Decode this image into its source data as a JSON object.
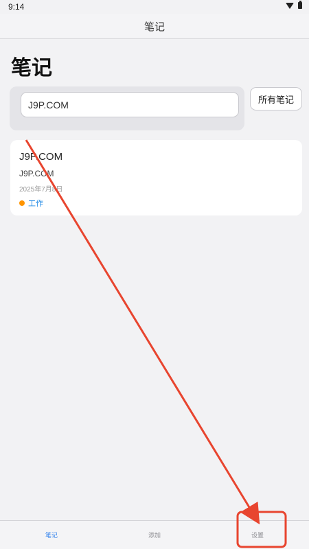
{
  "status_bar": {
    "time": "9:14"
  },
  "nav": {
    "title": "笔记"
  },
  "page": {
    "title": "笔记"
  },
  "search": {
    "value": "J9P.COM"
  },
  "filter": {
    "label": "所有笔记"
  },
  "notes": [
    {
      "title": "J9P.COM",
      "body": "J9P.COM",
      "date": "2025年7月8日",
      "tag": "工作",
      "tag_color": "#ff9500"
    }
  ],
  "tabs": [
    {
      "label": "笔记",
      "active": true
    },
    {
      "label": "添加",
      "active": false
    },
    {
      "label": "设置",
      "active": false
    }
  ],
  "colors": {
    "accent": "#2f80ed",
    "annotation": "#e8452f",
    "tag": "#ff9500"
  }
}
